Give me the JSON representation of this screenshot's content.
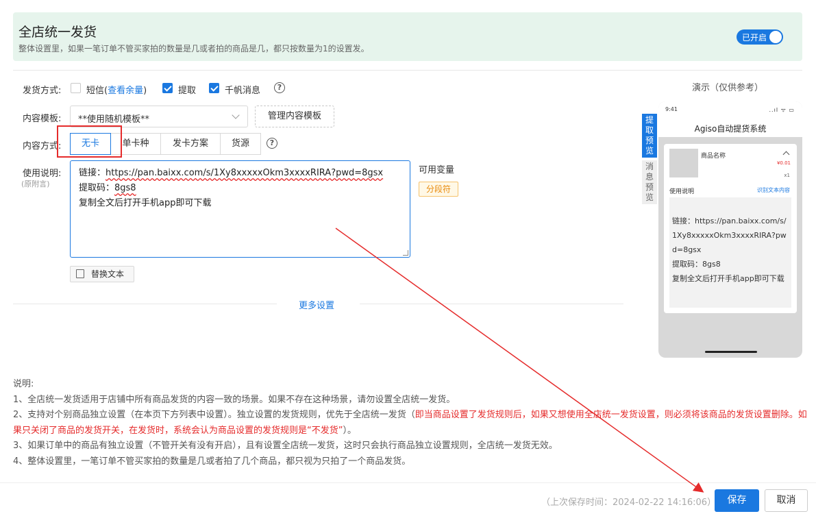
{
  "banner": {
    "title": "全店统一发货",
    "description": "整体设置里，如果一笔订单不管买家拍的数量是几或者拍的商品是几，都只按数量为1的设置发。",
    "toggle_label": "已开启"
  },
  "delivery_method": {
    "label": "发货方式:",
    "sms_label": "短信",
    "sms_paren_open": "(",
    "sms_link": "查看余量",
    "sms_paren_close": ")",
    "sms_checked": false,
    "pickup_label": "提取",
    "pickup_checked": true,
    "qianniu_label": "千帆消息",
    "qianniu_checked": true
  },
  "content_template": {
    "label": "内容模板:",
    "selected": "**使用随机模板**",
    "manage_button": "管理内容模板"
  },
  "content_method": {
    "label": "内容方式:",
    "options": [
      "无卡",
      "单卡种",
      "发卡方案",
      "货源"
    ],
    "selected": "无卡"
  },
  "usage": {
    "label": "使用说明:",
    "sublabel": "(原附言)",
    "line1_prefix": "链接：",
    "line1_url": "https://pan.baixx.com/s/1Xy8xxxxxOkm3xxxxRIRA?pwd=8gsx",
    "line2_prefix": "提取码：",
    "line2_code": "8gs8",
    "line3": "复制全文后打开手机app即可下载",
    "variables_title": "可用变量",
    "variable_tag": "分段符",
    "replace_button": "替换文本"
  },
  "more_settings": "更多设置",
  "demo": {
    "title": "演示（仅供参考）",
    "tab_pickup": "提取预览",
    "tab_message": "消息预览",
    "phone_time": "9:41",
    "phone_status": "..ıl ᯤ ▭",
    "system_title": "Agiso自动提货系统",
    "product_name": "商品名称",
    "price": "¥0.01",
    "qty": "x1",
    "usage_label": "使用说明",
    "recognize": "识别文本内容",
    "content_line1": "链接：https://pan.baixx.com/s/1Xy8xxxxxOkm3xxxxRIRA?pwd=8gsx",
    "content_line2": "提取码：8gs8",
    "content_line3": "复制全文后打开手机app即可下载"
  },
  "notes": {
    "title": "说明:",
    "item1": "1、全店统一发货适用于店铺中所有商品发货的内容一致的场景。如果不存在这种场景，请勿设置全店统一发货。",
    "item2_plain": "2、支持对个别商品独立设置（在本页下方列表中设置）。独立设置的发货规则，优先于全店统一发货（",
    "item2_red": "即当商品设置了发货规则后，如果又想使用全店统一发货设置，则必须将该商品的发货设置删除。如果只关闭了商品的发货开关，在发货时，系统会认为商品设置的发货规则是“不发货”",
    "item2_end": "）。",
    "item3": "3、如果订单中的商品有独立设置（不管开关有没有开启），且有设置全店统一发货，这时只会执行商品独立设置规则，全店统一发货无效。",
    "item4": "4、整体设置里，一笔订单不管买家拍的数量是几或者拍了几个商品，都只视为只拍了一个商品发货。"
  },
  "footer": {
    "last_saved": "（上次保存时间：2024-02-22 14:16:06）",
    "save_button": "保存",
    "cancel_button": "取消"
  },
  "colors": {
    "accent": "#1a78e0",
    "banner_bg": "#e6f4ec",
    "warning_red": "#e52b2b",
    "annotation_red": "#e52b2b"
  }
}
